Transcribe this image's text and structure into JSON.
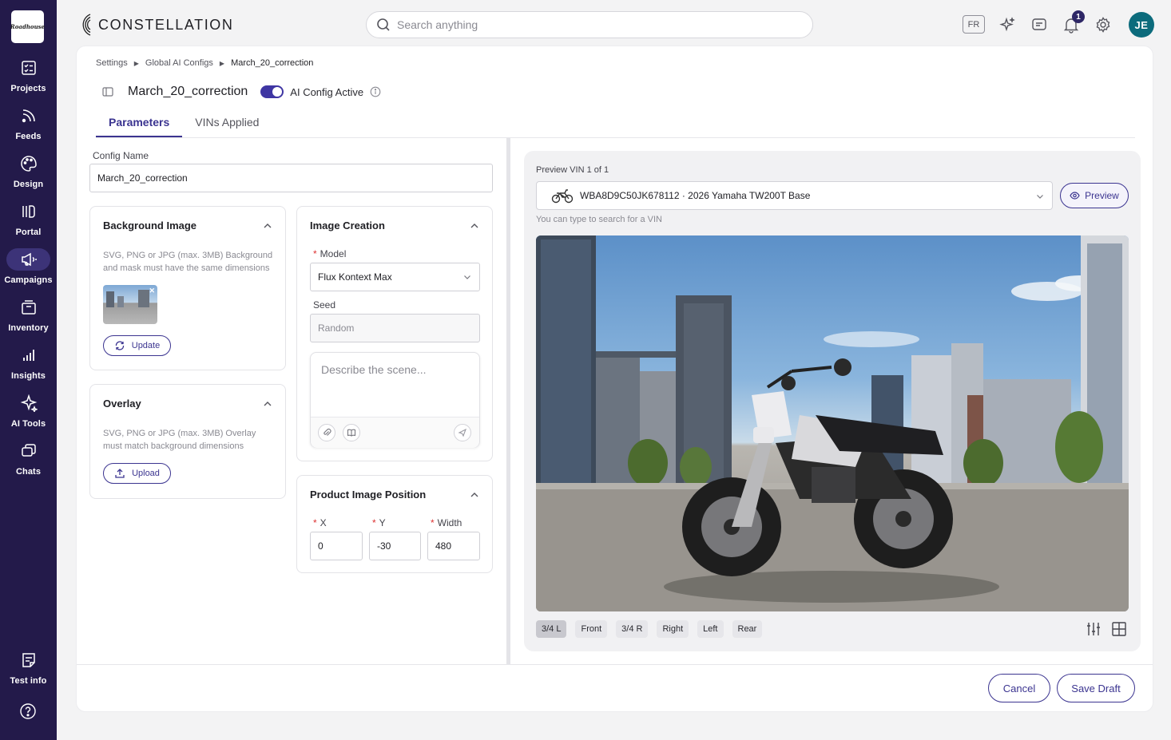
{
  "sidebar": {
    "logo_text": "Roadhouse",
    "items": [
      {
        "label": "Projects",
        "icon": "projects-icon"
      },
      {
        "label": "Feeds",
        "icon": "feeds-icon"
      },
      {
        "label": "Design",
        "icon": "design-icon"
      },
      {
        "label": "Portal",
        "icon": "portal-icon"
      },
      {
        "label": "Campaigns",
        "icon": "campaigns-icon",
        "active": true
      },
      {
        "label": "Inventory",
        "icon": "inventory-icon"
      },
      {
        "label": "Insights",
        "icon": "insights-icon"
      },
      {
        "label": "AI Tools",
        "icon": "ai-tools-icon"
      },
      {
        "label": "Chats",
        "icon": "chats-icon"
      }
    ],
    "bottom": {
      "label": "Test info",
      "icon": "test-info-icon",
      "help_icon": "help-icon"
    }
  },
  "topbar": {
    "brand": "CONSTELLATION",
    "search_placeholder": "Search anything",
    "lang": "FR",
    "notif_count": "1",
    "avatar": "JE"
  },
  "breadcrumb": [
    "Settings",
    "Global AI Configs",
    "March_20_correction"
  ],
  "page": {
    "title": "March_20_correction",
    "toggle_label": "AI Config Active",
    "tabs": [
      "Parameters",
      "VINs Applied"
    ]
  },
  "form": {
    "config_name_label": "Config Name",
    "config_name_value": "March_20_correction",
    "background": {
      "title": "Background Image",
      "desc": "SVG, PNG or JPG (max. 3MB) Background and mask must have the same dimensions",
      "button": "Update"
    },
    "overlay": {
      "title": "Overlay",
      "desc": "SVG, PNG or JPG (max. 3MB) Overlay must match background dimensions",
      "button": "Upload"
    },
    "image_creation": {
      "title": "Image Creation",
      "model_label": "Model",
      "model_value": "Flux Kontext Max",
      "seed_label": "Seed",
      "seed_placeholder": "Random",
      "prompt_placeholder": "Describe the scene..."
    },
    "position": {
      "title": "Product Image Position",
      "x_label": "X",
      "x_value": "0",
      "y_label": "Y",
      "y_value": "-30",
      "width_label": "Width",
      "width_value": "480"
    }
  },
  "preview": {
    "label": "Preview VIN 1 of 1",
    "vin": "WBA8D9C50JK678112 · 2026 Yamaha TW200T Base",
    "button": "Preview",
    "hint": "You can type to search for a VIN",
    "angles": [
      "3/4 L",
      "Front",
      "3/4 R",
      "Right",
      "Left",
      "Rear"
    ],
    "active_angle": "3/4 L"
  },
  "footer": {
    "cancel": "Cancel",
    "save": "Save Draft"
  },
  "colors": {
    "sidebar": "#231a4a",
    "accent": "#3b3490",
    "avatar": "#0c6b7c"
  }
}
